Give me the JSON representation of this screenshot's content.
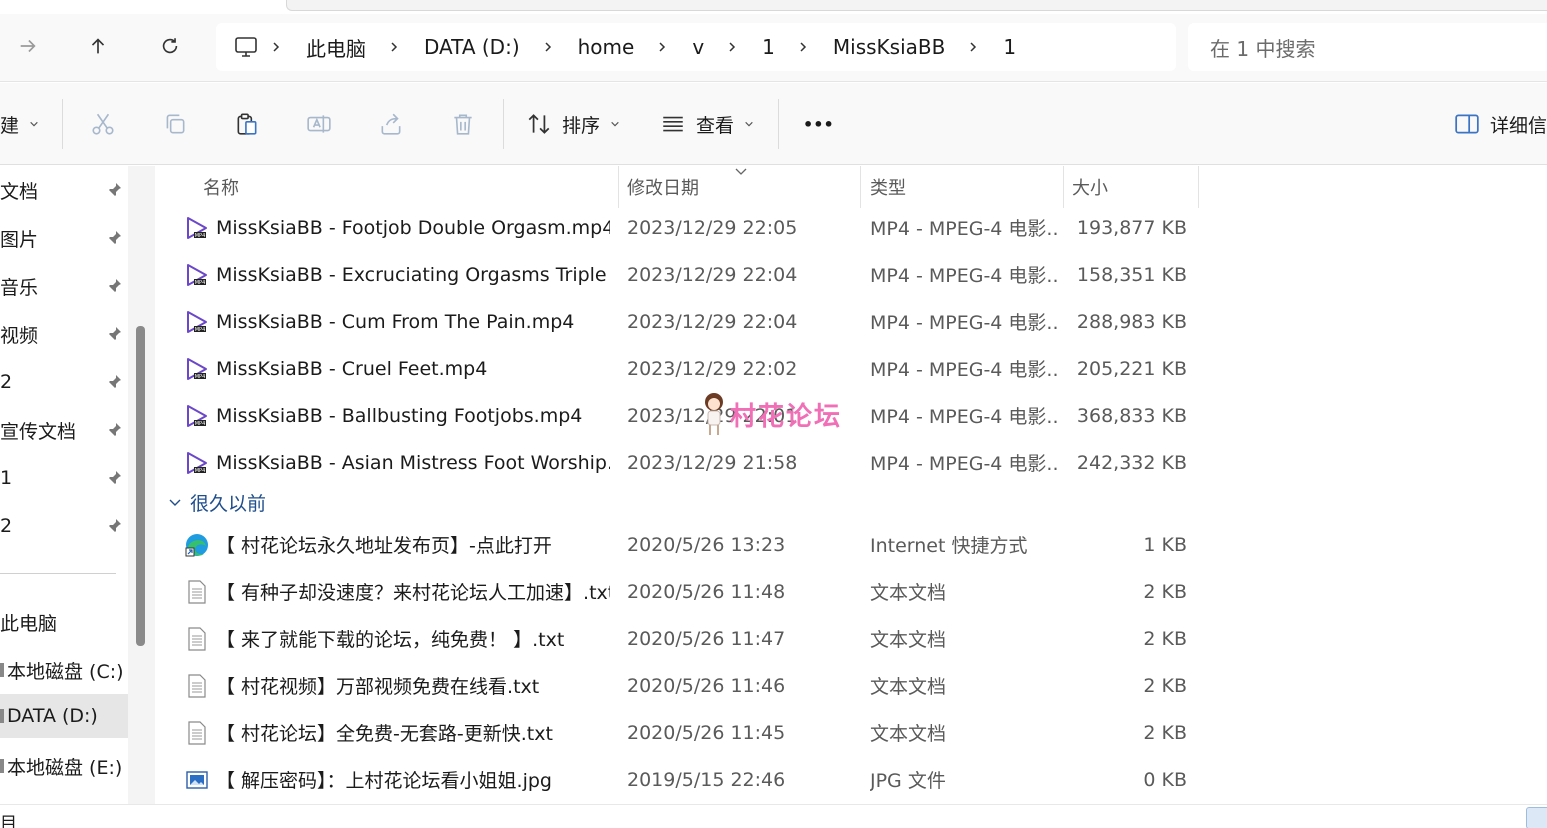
{
  "nav": {
    "breadcrumbs": [
      "此电脑",
      "DATA (D:)",
      "home",
      "v",
      "1",
      "MissKsiaBB",
      "1"
    ],
    "search_placeholder": "在 1 中搜索"
  },
  "toolbar": {
    "new_label": "建",
    "sort_label": "排序",
    "view_label": "查看",
    "more_label": "•••",
    "details_label": "详细信"
  },
  "sidebar": {
    "pinned": [
      "文档",
      "图片",
      "音乐",
      "视频",
      "2",
      "宣传文档",
      "1",
      "2"
    ],
    "drives": [
      "此电脑",
      "本地磁盘 (C:)",
      "DATA (D:)",
      "本地磁盘 (E:)"
    ]
  },
  "columns": {
    "name": "名称",
    "date": "修改日期",
    "type": "类型",
    "size": "大小"
  },
  "files_recent": [
    {
      "icon": "video-icon",
      "name": "MissKsiaBB - Footjob Double Orgasm.mp4",
      "date": "2023/12/29 22:05",
      "type": "MP4 - MPEG-4 电影...",
      "size": "193,877 KB"
    },
    {
      "icon": "video-icon",
      "name": "MissKsiaBB - Excruciating Orgasms Triple O...",
      "date": "2023/12/29 22:04",
      "type": "MP4 - MPEG-4 电影...",
      "size": "158,351 KB"
    },
    {
      "icon": "video-icon",
      "name": "MissKsiaBB - Cum From The Pain.mp4",
      "date": "2023/12/29 22:04",
      "type": "MP4 - MPEG-4 电影...",
      "size": "288,983 KB"
    },
    {
      "icon": "video-icon",
      "name": "MissKsiaBB - Cruel Feet.mp4",
      "date": "2023/12/29 22:02",
      "type": "MP4 - MPEG-4 电影...",
      "size": "205,221 KB"
    },
    {
      "icon": "video-icon",
      "name": "MissKsiaBB - Ballbusting Footjobs.mp4",
      "date": "2023/12/29 22:01",
      "type": "MP4 - MPEG-4 电影...",
      "size": "368,833 KB"
    },
    {
      "icon": "video-icon",
      "name": "MissKsiaBB - Asian Mistress Foot Worship.m...",
      "date": "2023/12/29 21:58",
      "type": "MP4 - MPEG-4 电影...",
      "size": "242,332 KB"
    }
  ],
  "group_old": "很久以前",
  "files_old": [
    {
      "icon": "edge-shortcut-icon",
      "name": "【 村花论坛永久地址发布页】-点此打开",
      "date": "2020/5/26 13:23",
      "type": "Internet 快捷方式",
      "size": "1 KB"
    },
    {
      "icon": "text-file-icon",
      "name": "【 有种子却没速度？来村花论坛人工加速】.txt",
      "date": "2020/5/26 11:48",
      "type": "文本文档",
      "size": "2 KB"
    },
    {
      "icon": "text-file-icon",
      "name": "【 来了就能下载的论坛，纯免费！ 】.txt",
      "date": "2020/5/26 11:47",
      "type": "文本文档",
      "size": "2 KB"
    },
    {
      "icon": "text-file-icon",
      "name": "【 村花视频】万部视频免费在线看.txt",
      "date": "2020/5/26 11:46",
      "type": "文本文档",
      "size": "2 KB"
    },
    {
      "icon": "text-file-icon",
      "name": "【 村花论坛】全免费-无套路-更新快.txt",
      "date": "2020/5/26 11:45",
      "type": "文本文档",
      "size": "2 KB"
    },
    {
      "icon": "image-file-icon",
      "name": "【 解压密码】：上村花论坛看小姐姐.jpg",
      "date": "2019/5/15 22:46",
      "type": "JPG 文件",
      "size": "0 KB"
    }
  ],
  "watermark": "村花论坛",
  "status": {
    "item_text": "目"
  },
  "colors": {
    "accent": "#3b74c4",
    "video_icon": "#6a48c9",
    "watermark": "#f06fb6",
    "selected_bg": "#e6e6e6"
  }
}
